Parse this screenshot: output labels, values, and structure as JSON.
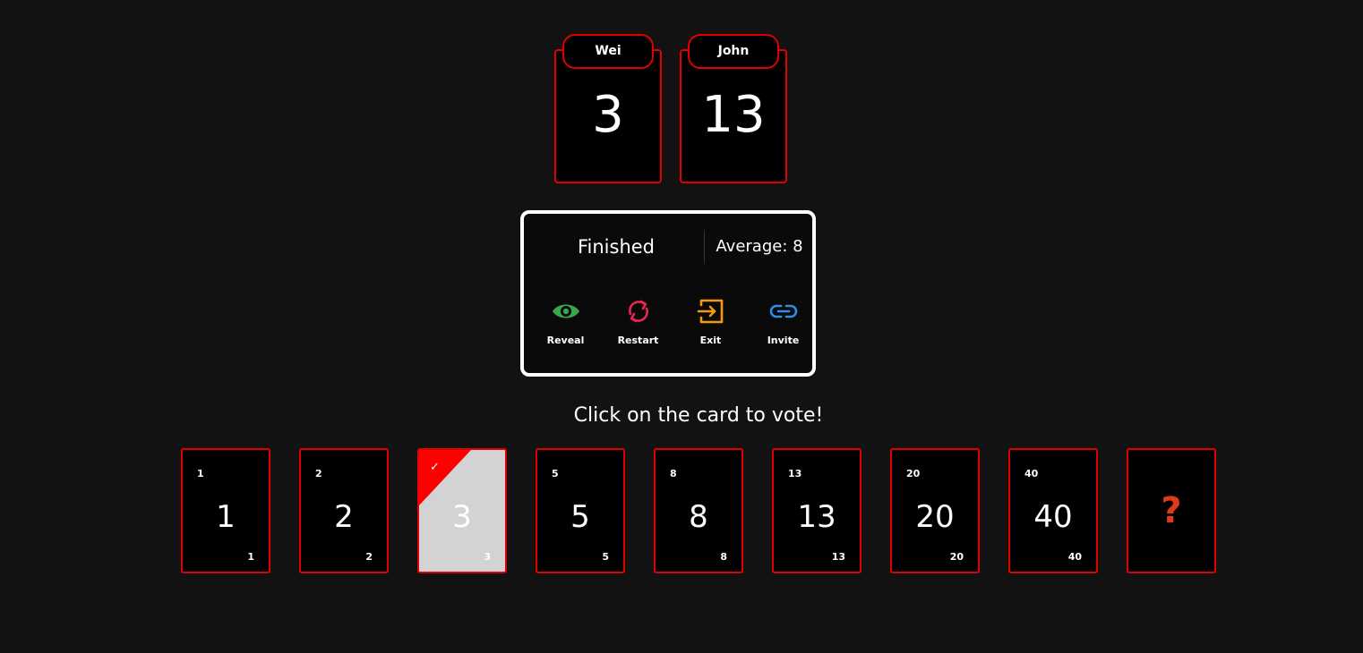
{
  "players": [
    {
      "name": "Wei",
      "vote": "3"
    },
    {
      "name": "John",
      "vote": "13"
    }
  ],
  "panel": {
    "status": "Finished",
    "average_label": "Average:",
    "average_value": "8",
    "actions": [
      {
        "label": "Reveal",
        "icon": "eye-icon",
        "color": "#3aa64a"
      },
      {
        "label": "Restart",
        "icon": "refresh-icon",
        "color": "#e8264f"
      },
      {
        "label": "Exit",
        "icon": "exit-icon",
        "color": "#f59b0b"
      },
      {
        "label": "Invite",
        "icon": "link-icon",
        "color": "#2f8ee8"
      }
    ]
  },
  "prompt": "Click on the card to vote!",
  "cards": [
    {
      "value": "1",
      "selected": false
    },
    {
      "value": "2",
      "selected": false
    },
    {
      "value": "3",
      "selected": true
    },
    {
      "value": "5",
      "selected": false
    },
    {
      "value": "8",
      "selected": false
    },
    {
      "value": "13",
      "selected": false
    },
    {
      "value": "20",
      "selected": false
    },
    {
      "value": "40",
      "selected": false
    },
    {
      "value": "?",
      "selected": false
    }
  ],
  "selected_mark": "✓",
  "colors": {
    "background": "#121212",
    "accent": "#e00000",
    "selected_card": "#d3d3d3",
    "question_mark": "#e03a1e"
  }
}
